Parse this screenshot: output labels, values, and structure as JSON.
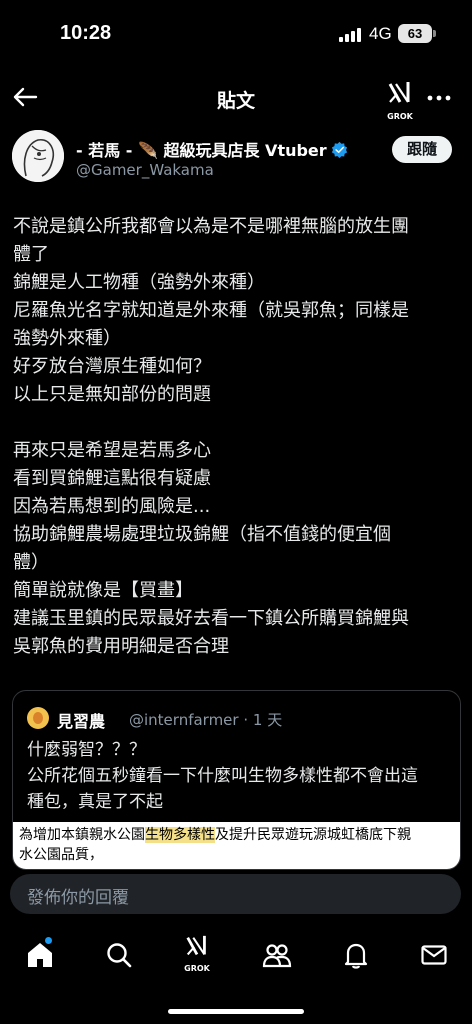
{
  "status": {
    "time": "10:28",
    "network": "4G",
    "battery": "63"
  },
  "header": {
    "title": "貼文",
    "grok_label": "GROK"
  },
  "author": {
    "name": "- 若馬 - 🪶 超級玩具店長 Vtuber",
    "handle": "@Gamer_Wakama",
    "follow_label": "跟隨"
  },
  "post": {
    "lines": [
      "不說是鎮公所我都會以為是不是哪裡無腦的放生團",
      "體了",
      "錦鯉是人工物種（強勢外來種）",
      "尼羅魚光名字就知道是外來種（就吳郭魚；同樣是",
      "強勢外來種）",
      "好歹放台灣原生種如何？",
      "以上只是無知部份的問題",
      "",
      "再來只是希望是若馬多心",
      "看到買錦鯉這點很有疑慮",
      "因為若馬想到的風險是...",
      "協助錦鯉農場處理垃圾錦鯉（指不值錢的便宜個",
      "體）",
      "簡單說就像是【買畫】",
      "建議玉里鎮的民眾最好去看一下鎮公所購買錦鯉與",
      "吳郭魚的費用明細是否合理"
    ]
  },
  "quote": {
    "name": "見習農",
    "handle": "@internfarmer · 1 天",
    "lines": [
      "什麼弱智？？？",
      "公所花個五秒鐘看一下什麼叫生物多樣性都不會出這",
      "種包，真是了不起"
    ],
    "image_text_before": "為增加本鎮親水公園",
    "image_text_highlight": "生物多樣性",
    "image_text_after": "及提升民眾遊玩源城虹橋底下親",
    "image_text_line2": "水公園品質，"
  },
  "reply": {
    "placeholder": "發佈你的回覆"
  },
  "nav": {
    "grok_label": "GROK"
  },
  "colors": {
    "accent": "#1d9bf0",
    "background": "#000000",
    "secondary_text": "#8b98a5",
    "highlight": "#f5e08a"
  },
  "icons": [
    "back-arrow-icon",
    "grok-icon",
    "more-icon",
    "verified-badge-icon",
    "home-icon",
    "search-icon",
    "people-icon",
    "bell-icon",
    "mail-icon"
  ]
}
